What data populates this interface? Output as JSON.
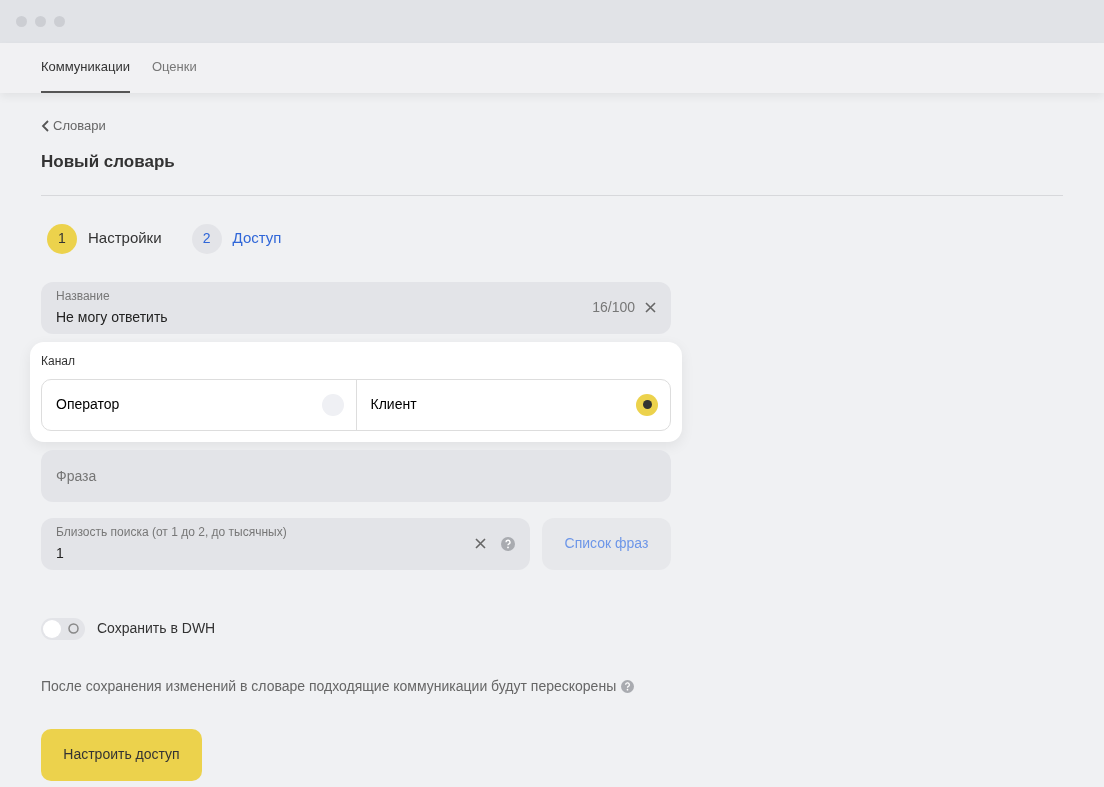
{
  "tabs": [
    {
      "label": "Коммуникации",
      "selected": true
    },
    {
      "label": "Оценки",
      "selected": false
    }
  ],
  "back_link": "Словари",
  "page_title": "Новый словарь",
  "steps": [
    {
      "number": "1",
      "label": "Настройки",
      "selected": true
    },
    {
      "number": "2",
      "label": "Доступ",
      "selected": false
    }
  ],
  "name_field": {
    "label": "Название",
    "value": "Не могу ответить",
    "counter": "16/100"
  },
  "channel": {
    "label": "Канал",
    "options": [
      {
        "label": "Оператор",
        "selected": false
      },
      {
        "label": "Клиент",
        "selected": true
      }
    ]
  },
  "phrase_field": {
    "placeholder": "Фраза"
  },
  "proximity_field": {
    "label": "Близость поиска (от 1 до 2, до тысячных)",
    "value": "1"
  },
  "phrase_list_button": "Список фраз",
  "dwh_toggle": {
    "label": "Сохранить в DWH",
    "on": false
  },
  "note": "После сохранения изменений в словаре подходящие коммуникации будут перескорены",
  "submit_button": "Настроить доступ"
}
